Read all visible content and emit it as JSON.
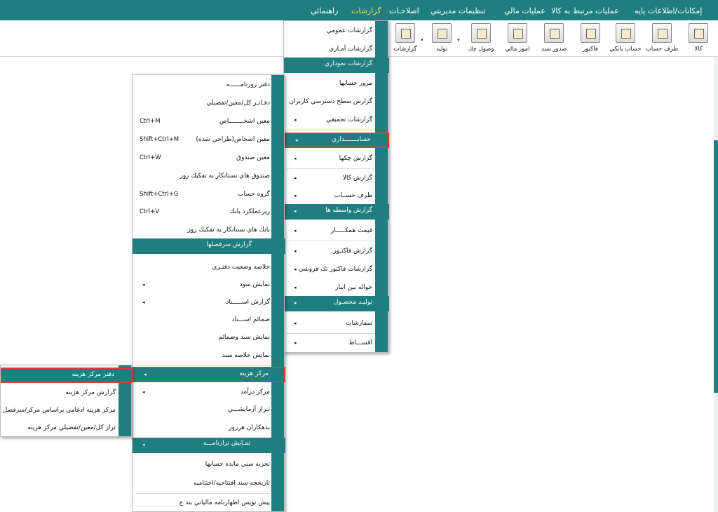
{
  "menubar": {
    "items": [
      {
        "label": "إمكانات/اطلاعات پايه"
      },
      {
        "label": "عمليات مرتبط به كالا"
      },
      {
        "label": "عمليات مالي"
      },
      {
        "label": "تنظيمات مديريتي"
      },
      {
        "label": "اصلاحـات"
      },
      {
        "label": "گزارشات"
      },
      {
        "label": "راهنمائي"
      }
    ],
    "active_color": "#ffd54a"
  },
  "toolbar": {
    "buttons": [
      {
        "label": "كالا",
        "icon": "box-icon"
      },
      {
        "label": "طرف حساب",
        "icon": "person-icon"
      },
      {
        "label": "حساب بانكي",
        "icon": "bank-card-icon"
      },
      {
        "label": "فاكتور",
        "icon": "invoice-icon"
      },
      {
        "label": "صدور سند",
        "icon": "document-edit-icon"
      },
      {
        "label": "امور مالي",
        "icon": "finance-icon"
      },
      {
        "label": "وصول چك",
        "icon": "check-envelope-icon"
      },
      {
        "label": "توليد",
        "icon": "production-icon"
      },
      {
        "label": "گزارشات",
        "icon": "report-chart-icon"
      }
    ]
  },
  "menu_reports": {
    "items": [
      {
        "label": "گزارشات عمومي"
      },
      {
        "label": "گزارشات آمـاري"
      },
      {
        "label": "گزارشات نموداري"
      },
      {
        "label": "مرور حسابها"
      },
      {
        "label": "گزارش سطح دسترسي كاربران"
      },
      {
        "label": "گزارشات تجميعي"
      },
      {
        "label": "حسابـــــــداري"
      },
      {
        "label": "گزارش چكها"
      },
      {
        "label": "گزارش كالا"
      },
      {
        "label": "طرف حســاب"
      },
      {
        "label": "گزارش واسطه ها"
      },
      {
        "label": "قيمت همكـــــار"
      },
      {
        "label": "گزارش فاكتـور"
      },
      {
        "label": "گزارشات فاكتور تك فروشي"
      },
      {
        "label": "حواله بين انبار"
      },
      {
        "label": "توليـد محصـول"
      },
      {
        "label": "سفارشات"
      },
      {
        "label": "اقســـاط"
      }
    ]
  },
  "menu_accounting": {
    "items": [
      {
        "label": "دفتر روزنامــــــه",
        "shortcut": ""
      },
      {
        "label": "دفـاتـر كل/معين/تفصيلي",
        "shortcut": ""
      },
      {
        "label": "معين اشخــــــــاص",
        "shortcut": "Ctrl+M"
      },
      {
        "label": "معين اشخاص(طراحي شده)",
        "shortcut": "Shift+Ctrl+M"
      },
      {
        "label": "معين صندوق",
        "shortcut": "Ctrl+W"
      },
      {
        "label": "صندوق هاي بستانكار به تفكيك روز",
        "shortcut": ""
      },
      {
        "label": "گروه حساب",
        "shortcut": "Shift+Ctrl+G"
      },
      {
        "label": "ريزعملكرد بانك",
        "shortcut": "Ctrl+V"
      },
      {
        "label": "بانك هاي بستانكار به تفكيك روز",
        "shortcut": ""
      },
      {
        "label": "گزارش سرفصلها",
        "shortcut": ""
      },
      {
        "label": "خلاصه وضعيت دفتـري",
        "shortcut": ""
      },
      {
        "label": "نمايش سود",
        "shortcut": ""
      },
      {
        "label": "گزارش اســـــناد",
        "shortcut": ""
      },
      {
        "label": "ضمائم اســـناد",
        "shortcut": ""
      },
      {
        "label": "نمايش سند وضمائم",
        "shortcut": ""
      },
      {
        "label": "نمايش خلاصه سند",
        "shortcut": ""
      },
      {
        "label": "مركز هزينه",
        "shortcut": ""
      },
      {
        "label": "مركز درآمد",
        "shortcut": ""
      },
      {
        "label": "تـراز آزمايشـــي",
        "shortcut": ""
      },
      {
        "label": "بدهكاران هرروز",
        "shortcut": ""
      },
      {
        "label": "نمـايش ترازنامـــه",
        "shortcut": ""
      },
      {
        "label": "تجزيه سني مانده حسابها",
        "shortcut": ""
      },
      {
        "label": "تاريخچه سند افتتاحيه/اختتاميه",
        "shortcut": ""
      },
      {
        "label": "پيش نويس اظهارنامه مالياتي بند ج",
        "shortcut": ""
      }
    ]
  },
  "menu_cost_center": {
    "items": [
      {
        "label": "دفتر مركز هزينه"
      },
      {
        "label": "گزارش مركز هزينه"
      },
      {
        "label": "مركز هزينه ادغامي براساس مركز/سرفصل"
      },
      {
        "label": "تراز كل/معين/تفصيلي مركز هزينه"
      }
    ]
  },
  "colors": {
    "accent": "#1f7f80",
    "highlight_border": "#e23a3a"
  }
}
